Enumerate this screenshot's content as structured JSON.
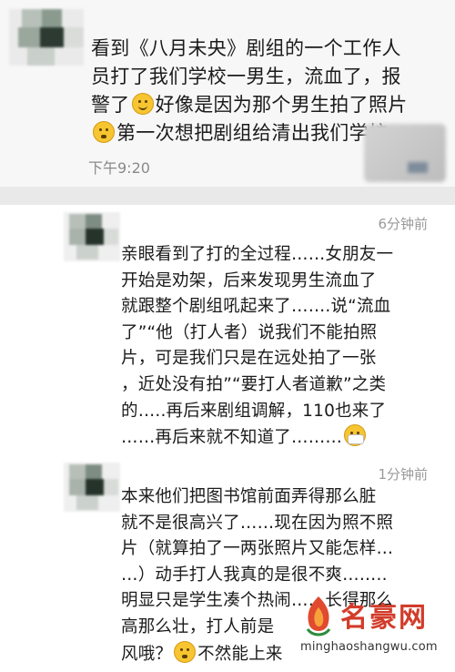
{
  "post": {
    "text_lines": [
      "看到《八月未央》剧组的一个工作人",
      "员打了我们学校一男生，流血了，报",
      "警了",
      "好像是因为那个男生拍了照片",
      "第一次想把剧组给清出我们学校"
    ],
    "time": "下午9:20",
    "emojis": [
      "smile-emoji",
      "flushed-emoji"
    ]
  },
  "comments": [
    {
      "time": "6分钟前",
      "lines": [
        "亲眼看到了打的全过程……女朋友一",
        "开始是劝架，后来发现男生流血了",
        "就跟整个剧组吼起来了…….说“流血",
        "了”“他（打人者）说我们不能拍照",
        "片，可是我们只是在远处拍了一张",
        "，近处没有拍”“要打人者道歉”之类",
        "的…..再后来剧组调解，110也来了",
        "……再后来就不知道了………"
      ],
      "end_emoji": "mask-emoji"
    },
    {
      "time": "1分钟前",
      "lines": [
        "本来他们把图书馆前面弄得那么脏",
        "就不是很高兴了……现在因为照不照",
        "片（就算拍了一两张照片又能怎样…",
        "…）动手打人我真的是很不爽……..",
        "明显只是学生凑个热闹……长得那么",
        "高那么壮，打人前是",
        "风哦？",
        "不然能上来"
      ],
      "inline_emoji": "flushed-emoji"
    }
  ],
  "watermark": {
    "title": "名豪网",
    "url": "minghaoshangwu.com"
  },
  "colors": {
    "text": "#1b1b1b",
    "meta": "#9a9a9a",
    "watermark_red": "#d23c2a"
  }
}
